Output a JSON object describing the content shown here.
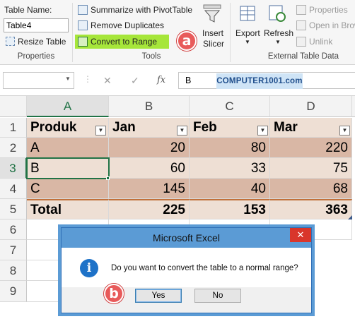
{
  "ribbon": {
    "properties": {
      "table_name_label": "Table Name:",
      "table_name_value": "Table4",
      "resize_table": "Resize Table",
      "group_label": "Properties"
    },
    "tools": {
      "summarize": "Summarize with PivotTable",
      "remove_duplicates": "Remove Duplicates",
      "convert_to_range": "Convert to Range",
      "insert_slicer_line1": "Insert",
      "insert_slicer_line2": "Slicer",
      "group_label": "Tools"
    },
    "external": {
      "export": "Export",
      "refresh": "Refresh",
      "properties": "Properties",
      "open_in_browser": "Open in Brow",
      "unlink": "Unlink",
      "group_label": "External Table Data"
    },
    "badge_a": "a"
  },
  "formula_bar": {
    "cancel_symbol": "✕",
    "enter_symbol": "✓",
    "fx_symbol": "fx",
    "value": "B",
    "watermark": "COMPUTER1001.com"
  },
  "grid": {
    "columns": [
      "A",
      "B",
      "C",
      "D"
    ],
    "rows": [
      "1",
      "2",
      "3",
      "4",
      "5",
      "6",
      "7",
      "8",
      "9"
    ],
    "header_row": [
      "Produk",
      "Jan",
      "Feb",
      "Mar"
    ],
    "data_rows": [
      [
        "A",
        "20",
        "80",
        "220"
      ],
      [
        "B",
        "60",
        "33",
        "75"
      ],
      [
        "C",
        "145",
        "40",
        "68"
      ]
    ],
    "total_row": [
      "Total",
      "225",
      "153",
      "363"
    ]
  },
  "dialog": {
    "title": "Microsoft Excel",
    "close": "✕",
    "message": "Do you want to convert the table to a normal range?",
    "yes": "Yes",
    "no": "No",
    "badge_b": "b"
  },
  "colors": {
    "accent_green": "#217346",
    "highlight": "#a6e63a",
    "badge": "#e85a5a",
    "dialog_title": "#5b9bd5",
    "table_band_dark": "#d9b7a5",
    "table_band_light": "#eedfd4"
  }
}
